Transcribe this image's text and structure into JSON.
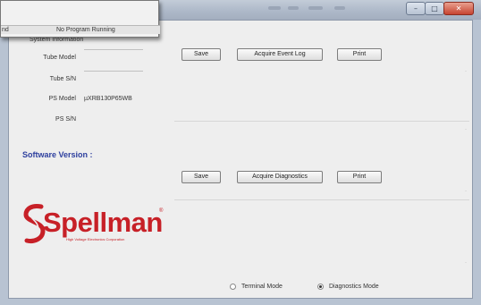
{
  "window": {
    "minimize_glyph": "–",
    "maximize_glyph": "□",
    "close_glyph": "✕"
  },
  "popup": {
    "row_label": "nd",
    "status": "No Program Running"
  },
  "system_information": {
    "title": "System Information",
    "tube_model_label": "Tube Model",
    "tube_sn_label": "Tube S/N",
    "ps_model_label": "PS Model",
    "ps_model_value": "µXRB130P65WB",
    "ps_sn_label": "PS S/N",
    "tube_model_value": "",
    "tube_sn_value": "",
    "ps_sn_value": ""
  },
  "event_log_toolbar": {
    "save_label": "Save",
    "acquire_label": "Acquire Event Log",
    "print_label": "Print"
  },
  "software_version": {
    "title": "Software Version :"
  },
  "diagnostics_toolbar": {
    "save_label": "Save",
    "acquire_label": "Acquire Diagnostics",
    "print_label": "Print"
  },
  "logo": {
    "name": "Spellman",
    "registered": "®",
    "tagline": "High Voltage Electronics Corporation"
  },
  "mode": {
    "terminal_label": "Terminal Mode",
    "diagnostics_label": "Diagnostics Mode",
    "selected": "Diagnostics Mode"
  }
}
